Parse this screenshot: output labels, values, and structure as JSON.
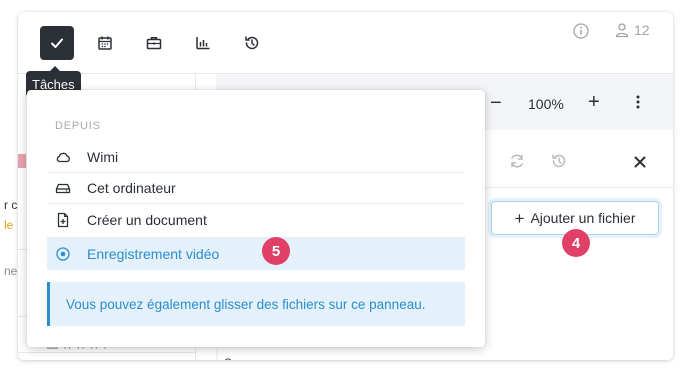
{
  "toolbar": {
    "tasks_tooltip": "Tâches",
    "buttons": [
      {
        "icon": "check-icon",
        "active": true
      },
      {
        "icon": "calendar-icon",
        "active": false
      },
      {
        "icon": "briefcase-icon",
        "active": false
      },
      {
        "icon": "bar-chart-icon",
        "active": false
      },
      {
        "icon": "history-icon",
        "active": false
      }
    ],
    "user_count": "12"
  },
  "viewer": {
    "zoom_out": "−",
    "zoom": "100%",
    "zoom_in": "+",
    "close": "×"
  },
  "add_file_button": {
    "plus": "+",
    "label": "Ajouter un fichier"
  },
  "dropdown": {
    "heading": "DEPUIS",
    "items": [
      {
        "label": "Wimi",
        "icon": "cloud-icon"
      },
      {
        "label": "Cet ordinateur",
        "icon": "hard-drive-icon"
      },
      {
        "label": "Créer un document",
        "icon": "new-document-icon"
      },
      {
        "label": "Enregistrement vidéo",
        "icon": "record-icon",
        "highlighted": true
      }
    ],
    "info": "Vous pouvez également glisser des fichiers sur ce panneau."
  },
  "badges": {
    "step_4": "4",
    "step_5": "5"
  },
  "background_fragments": {
    "f1": "r c",
    "f2": "le",
    "f3": "ne",
    "f4": "— ·· ·· ·· ·",
    "f5": "S"
  },
  "colors": {
    "accent": "#2a8fcf",
    "badge": "#e04066",
    "tooltip_bg": "#2b2f36",
    "highlight_bg": "#e4f1fb"
  }
}
